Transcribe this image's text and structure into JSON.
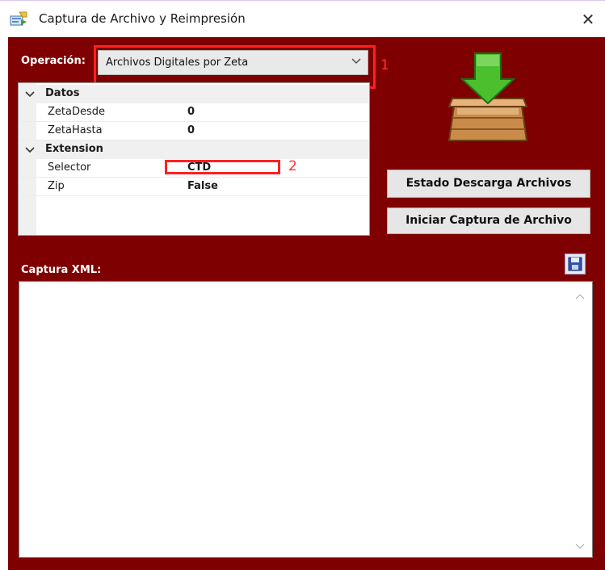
{
  "window": {
    "title": "Captura de Archivo y Reimpresión",
    "close_glyph": "✕",
    "icon": "app-icon",
    "background_color": "#7f0000"
  },
  "operation": {
    "label": "Operación:",
    "selected": "Archivos Digitales por Zeta"
  },
  "annotations": [
    {
      "number": "1",
      "target": "operation-select",
      "color": "#ff2020"
    },
    {
      "number": "2",
      "target": "selector-value",
      "color": "#ff2020"
    }
  ],
  "property_grid": {
    "categories": [
      {
        "name": "Datos",
        "properties": [
          {
            "name": "ZetaDesde",
            "value": "0"
          },
          {
            "name": "ZetaHasta",
            "value": "0"
          }
        ]
      },
      {
        "name": "Extension",
        "properties": [
          {
            "name": "Selector",
            "value": "CTD"
          },
          {
            "name": "Zip",
            "value": "False"
          }
        ]
      }
    ]
  },
  "buttons": {
    "estado": "Estado Descarga Archivos",
    "iniciar": "Iniciar Captura de Archivo"
  },
  "xml": {
    "label": "Captura XML:",
    "content": ""
  },
  "icons": {
    "download_box": "download-box-icon",
    "save": "save-icon"
  }
}
